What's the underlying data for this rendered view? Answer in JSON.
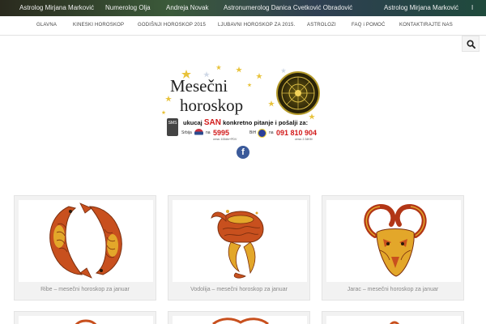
{
  "topbar": {
    "items": [
      "Astrolog Mirjana Marković",
      "Numerolog Olja",
      "Andreja Novak",
      "Astronumerolog Danica Cvetković Obradović",
      "Astrolog Mirjana Marković",
      "I"
    ]
  },
  "nav": {
    "items": [
      "GLAVNA",
      "KINESKI HOROSKOP",
      "GODIŠNJI HOROSKOP 2015",
      "LJUBAVNI HOROSKOP ZA 2015.",
      "ASTROLOZI",
      "FAQ i POMOĆ",
      "KONTAKTIRAJTE NAS"
    ]
  },
  "banner": {
    "title_line1": "Mesečni",
    "title_line2": "horoskop",
    "sms_label": "SMS",
    "instruction_prefix": "ukucaj",
    "keyword": "SAN",
    "instruction_suffix": "konkretno pitanje i pošalji za:",
    "serbia_label": "Srbija",
    "serbia_prefix": "na",
    "serbia_number": "5995",
    "serbia_price": "cena: 100din+PDV",
    "bih_label": "BiH",
    "bih_prefix": "na",
    "bih_number": "091 810 904",
    "bih_price": "cena: 2.34KM"
  },
  "social": {
    "facebook_label": "f"
  },
  "cards": [
    {
      "caption": "Ribe – mesečni horoskop za januar",
      "icon": "pisces-icon"
    },
    {
      "caption": "Vodolija – mesečni horoskop za januar",
      "icon": "aquarius-icon"
    },
    {
      "caption": "Jarac – mesečni horoskop za januar",
      "icon": "capricorn-icon"
    }
  ],
  "colors": {
    "accent_red": "#d21a1a",
    "facebook_blue": "#3b5a9a",
    "zodiac_orange": "#c8501e",
    "zodiac_yellow": "#e3a72a"
  }
}
